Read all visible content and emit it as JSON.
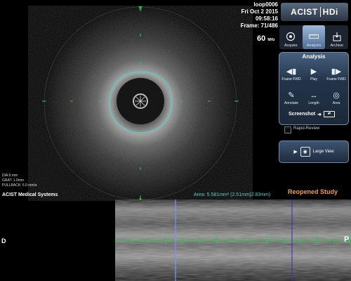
{
  "header": {
    "filename": "loop0006",
    "date": "Fri Oct 2 2015",
    "time": "09:58:16",
    "frame": "Frame: 71/486"
  },
  "logo": {
    "brand": "ACIST",
    "product": "HDi"
  },
  "frequency": {
    "value": "60",
    "unit": "MHz"
  },
  "tabs": [
    {
      "label": "Acquire",
      "icon": "acquire-icon"
    },
    {
      "label": "Analysis",
      "icon": "ruler-icon"
    },
    {
      "label": "Archive",
      "icon": "archive-icon"
    }
  ],
  "analysis_panel": {
    "title": "Analysis",
    "buttons": [
      {
        "label": "Frame FWD",
        "icon": "frame-back-icon"
      },
      {
        "label": "Play",
        "icon": "play-icon"
      },
      {
        "label": "Frame FWD",
        "icon": "frame-forward-icon"
      },
      {
        "label": "Annotate",
        "icon": "annotate-icon"
      },
      {
        "label": "Length",
        "icon": "length-icon"
      },
      {
        "label": "Area",
        "icon": "area-icon"
      }
    ],
    "screenshot_label": "Screenshot"
  },
  "rapid_review": {
    "label": "Rapid-Review",
    "checked": false
  },
  "large_view": {
    "label": "Large View"
  },
  "params": {
    "dia": "DIA:6 mm",
    "grat": "GRAT: 1.0mm",
    "pullback": "PULLBACK: 5.0 mm/s"
  },
  "company": "ACIST Medical Systems",
  "area": "Area:  5.581mm² (2.51mm|2.83mm)",
  "status": "Reopened Study",
  "longitudinal": {
    "left_label": "D",
    "right_label": "P"
  },
  "colors": {
    "measure": "#4fd0c8",
    "grid": "#22cc44",
    "status": "#f0a030",
    "cursor": "#6c6cff"
  }
}
